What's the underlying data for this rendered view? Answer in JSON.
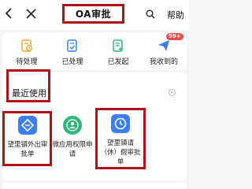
{
  "header": {
    "title": "OA审批",
    "help_label": "帮助"
  },
  "quick_actions": [
    {
      "label": "待处理",
      "icon": "pending-doc-icon"
    },
    {
      "label": "已处理",
      "icon": "processed-doc-icon"
    },
    {
      "label": "已发起",
      "icon": "initiated-doc-icon"
    },
    {
      "label": "我收到的",
      "icon": "send-plane-icon",
      "badge": "99+"
    }
  ],
  "recent": {
    "title": "最近使用",
    "apps": [
      {
        "label_lines": [
          "望里镇外出审",
          "批单"
        ],
        "icon": "outing-approval-icon",
        "color": "#3d7df5"
      },
      {
        "label_lines": [
          "微应用权限申",
          "请"
        ],
        "icon": "permission-user-icon",
        "color": "#31b77a"
      },
      {
        "label_lines": [
          "望里镇请",
          "（休）假审批",
          "单"
        ],
        "icon": "leave-clock-icon",
        "color": "#3d7df5"
      }
    ]
  },
  "colors": {
    "accent_blue": "#3d7df5",
    "green": "#31b77a",
    "orange": "#f5a623",
    "badge_red": "#f04848",
    "highlight_red": "#b40f14"
  }
}
